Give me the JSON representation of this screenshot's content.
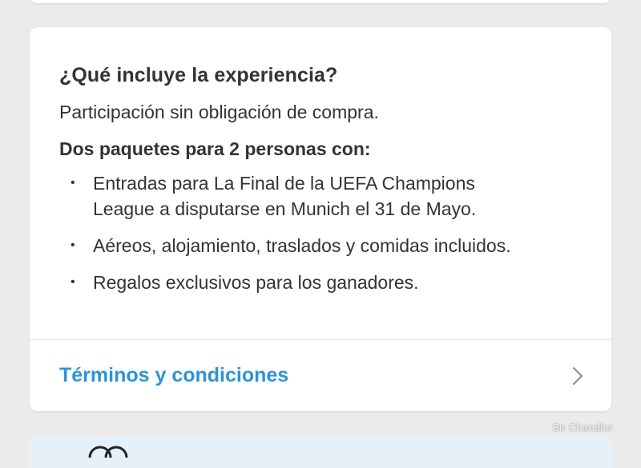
{
  "experience_card": {
    "title": "¿Qué incluye la experiencia?",
    "intro": "Participación sin obligación de compra.",
    "subtitle": "Dos paquetes para 2 personas con:",
    "bullet_symbol": "•",
    "benefits": [
      {
        "line1": "Entradas para La Final de la UEFA Champions",
        "line2": "League a disputarse en Munich el 31 de Mayo."
      },
      {
        "line1": "Aéreos, alojamiento, traslados y comidas incluidos.",
        "line2": ""
      },
      {
        "line1": "Regalos exclusivos para los ganadores.",
        "line2": ""
      }
    ],
    "terms_label": "Términos y condiciones",
    "terms_icon": "chevron-right-icon"
  },
  "next_card": {
    "logo_icon": "interlocking-rings-logo"
  },
  "watermark": "Sir Chandler",
  "colors": {
    "link": "#2d93d6",
    "text": "#333333",
    "background": "#ebebeb",
    "card": "#ffffff",
    "next_card": "#e6f0f8"
  }
}
